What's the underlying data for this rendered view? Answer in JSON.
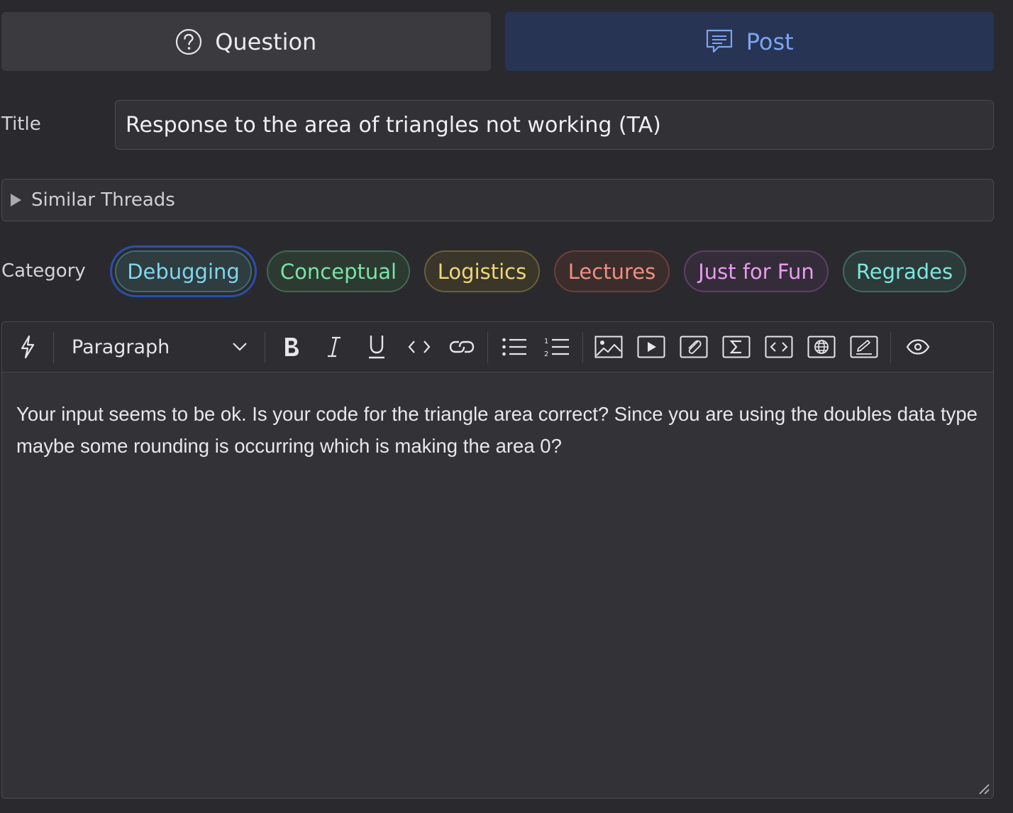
{
  "post_type": {
    "question_label": "Question",
    "post_label": "Post",
    "selected": "Post"
  },
  "title": {
    "label": "Title",
    "value": "Response to the area of triangles not working (TA)"
  },
  "similar_threads": {
    "label": "Similar Threads"
  },
  "category": {
    "label": "Category",
    "selected": "Debugging",
    "chips": [
      {
        "label": "Debugging",
        "color": "#7fd6ec",
        "border": "#3f6b73",
        "bg": "#2f3c40"
      },
      {
        "label": "Conceptual",
        "color": "#7be3a5",
        "border": "#3f6a50",
        "bg": "#2d3a32"
      },
      {
        "label": "Logistics",
        "color": "#f1d67a",
        "border": "#6a5f35",
        "bg": "#3a362a"
      },
      {
        "label": "Lectures",
        "color": "#f09080",
        "border": "#6d3f38",
        "bg": "#3b2d2c"
      },
      {
        "label": "Just for Fun",
        "color": "#e79cf0",
        "border": "#5f3f68",
        "bg": "#352c39"
      },
      {
        "label": "Regrades",
        "color": "#7ee6de",
        "border": "#3f6a66",
        "bg": "#2c3a39"
      }
    ]
  },
  "editor": {
    "format_select": "Paragraph",
    "toolbar_icons": [
      "lightning-icon",
      "bold-icon",
      "italic-icon",
      "underline-icon",
      "code-icon",
      "link-icon",
      "bullet-list-icon",
      "numbered-list-icon",
      "image-icon",
      "video-icon",
      "attachment-icon",
      "math-icon",
      "code-block-icon",
      "web-snippet-icon",
      "drawing-icon",
      "preview-icon"
    ],
    "body": "Your input seems to be ok. Is your code for the triangle area correct? Since you are using the doubles data type maybe some rounding is occurring which is making the area 0?"
  },
  "colors": {
    "background": "#2a2a2e",
    "post_selected_bg": "#283454",
    "post_selected_fg": "#7aa4ef",
    "selected_ring": "#2b4fa8"
  }
}
